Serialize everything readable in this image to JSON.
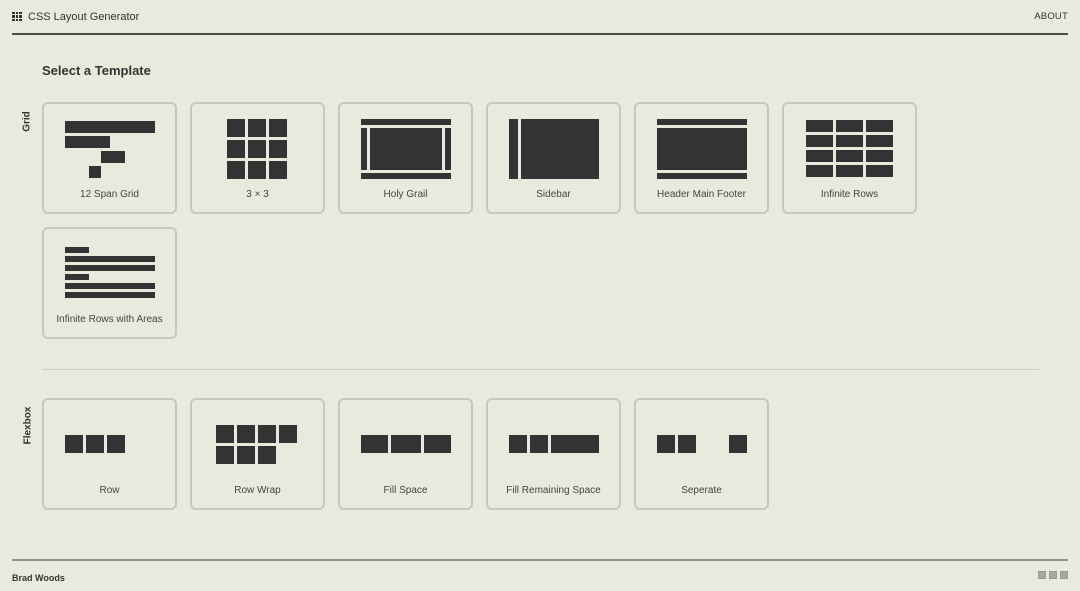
{
  "header": {
    "title": "CSS Layout Generator",
    "logo_icon": "grid-icon",
    "about_label": "ABOUT"
  },
  "main": {
    "title": "Select a Template",
    "sections": [
      {
        "label": "Grid",
        "templates": [
          {
            "label": "12 Span Grid",
            "icon": "twelve-span-grid-icon"
          },
          {
            "label": "3 × 3",
            "icon": "three-by-three-icon"
          },
          {
            "label": "Holy Grail",
            "icon": "holy-grail-icon"
          },
          {
            "label": "Sidebar",
            "icon": "sidebar-icon"
          },
          {
            "label": "Header Main Footer",
            "icon": "header-main-footer-icon"
          },
          {
            "label": "Infinite Rows",
            "icon": "infinite-rows-icon"
          },
          {
            "label": "Infinite Rows with Areas",
            "icon": "infinite-rows-areas-icon"
          }
        ]
      },
      {
        "label": "Flexbox",
        "templates": [
          {
            "label": "Row",
            "icon": "row-icon"
          },
          {
            "label": "Row Wrap",
            "icon": "row-wrap-icon"
          },
          {
            "label": "Fill Space",
            "icon": "fill-space-icon"
          },
          {
            "label": "Fill Remaining Space",
            "icon": "fill-remaining-space-icon"
          },
          {
            "label": "Seperate",
            "icon": "seperate-icon"
          }
        ]
      }
    ]
  },
  "footer": {
    "author": "Brad Woods",
    "theme_swatches": [
      "theme-swatch-1",
      "theme-swatch-2",
      "theme-swatch-3"
    ]
  }
}
